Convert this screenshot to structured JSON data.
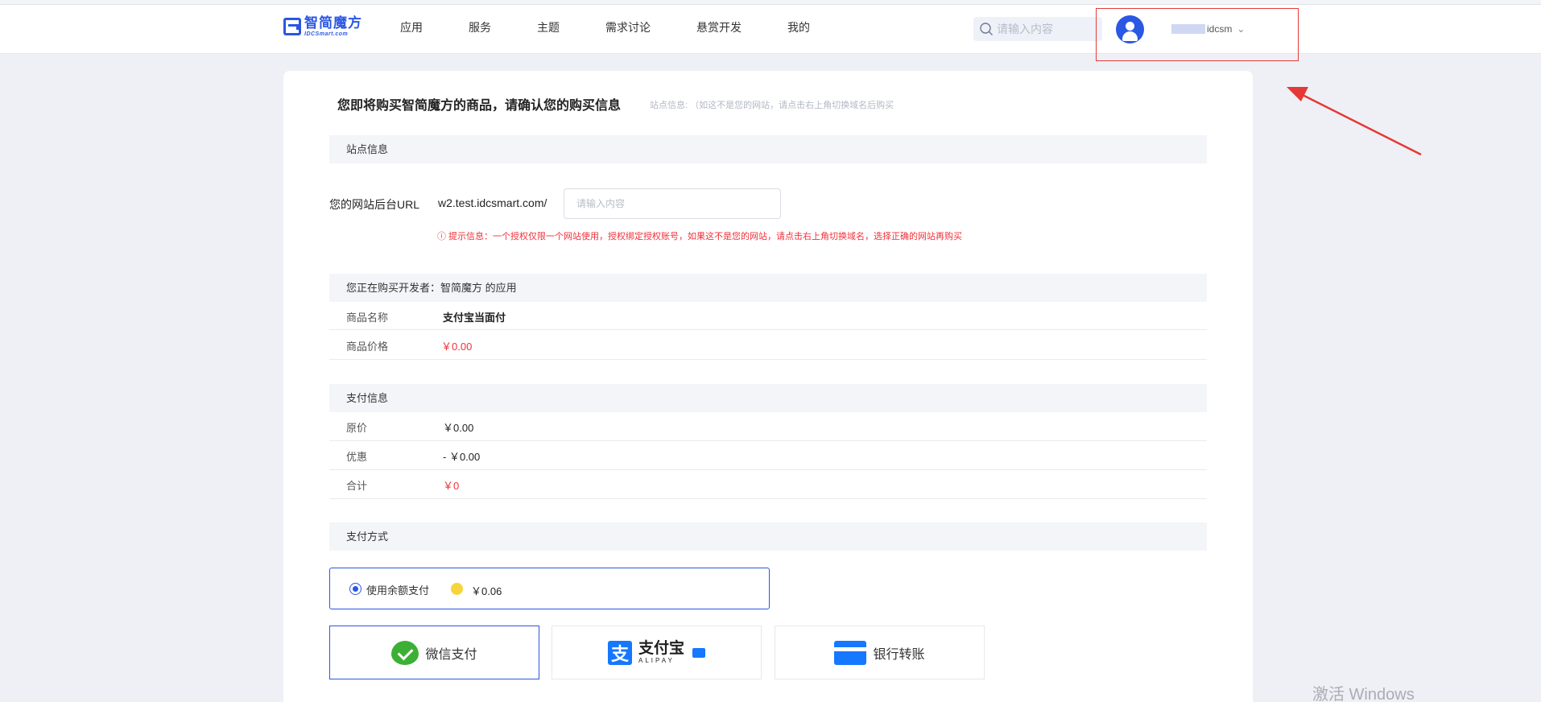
{
  "header": {
    "logo_cn": "智简魔方",
    "logo_en": "IDCSmart.com",
    "nav": [
      "应用",
      "服务",
      "主题",
      "需求讨论",
      "悬赏开发",
      "我的"
    ],
    "search_placeholder": "请输入内容",
    "username_visible": "idcsm",
    "dropdown_glyph": "⌄"
  },
  "page": {
    "title": "您即将购买智简魔方的商品，请确认您的购买信息",
    "subtitle": "站点信息: （如这不是您的网站，请点击右上角切换域名后购买"
  },
  "site_info": {
    "section_title": "站点信息",
    "url_label": "您的网站后台URL",
    "url_value": "w2.test.idcsmart.com/",
    "input_placeholder": "请输入内容",
    "hint": "ⓘ 提示信息：一个授权仅限一个网站使用，授权绑定授权账号，如果这不是您的网站，请点击右上角切换域名，选择正确的网站再购买"
  },
  "product": {
    "section_title": "您正在购买开发者：智简魔方 的应用",
    "name_label": "商品名称",
    "name_value": "支付宝当面付",
    "price_label": "商品价格",
    "price_value": "￥0.00"
  },
  "payment_info": {
    "section_title": "支付信息",
    "rows": [
      {
        "label": "原价",
        "value": "￥0.00"
      },
      {
        "label": "优惠",
        "value": "- ￥0.00"
      },
      {
        "label": "合计",
        "value": "￥0"
      }
    ]
  },
  "payment_method": {
    "section_title": "支付方式",
    "balance_label": "使用余额支付",
    "balance_amount": "￥0.06",
    "wechat_label": "微信支付",
    "alipay_mark": "支",
    "alipay_cn": "支付宝",
    "alipay_en": "ALIPAY",
    "bank_label": "银行转账"
  },
  "watermark": "激活 Windows",
  "colors": {
    "brand": "#2a57e4",
    "price_red": "#f0313a",
    "annotation_red": "#e53935",
    "wechat_green": "#3cb035",
    "alipay_blue": "#1677ff"
  }
}
